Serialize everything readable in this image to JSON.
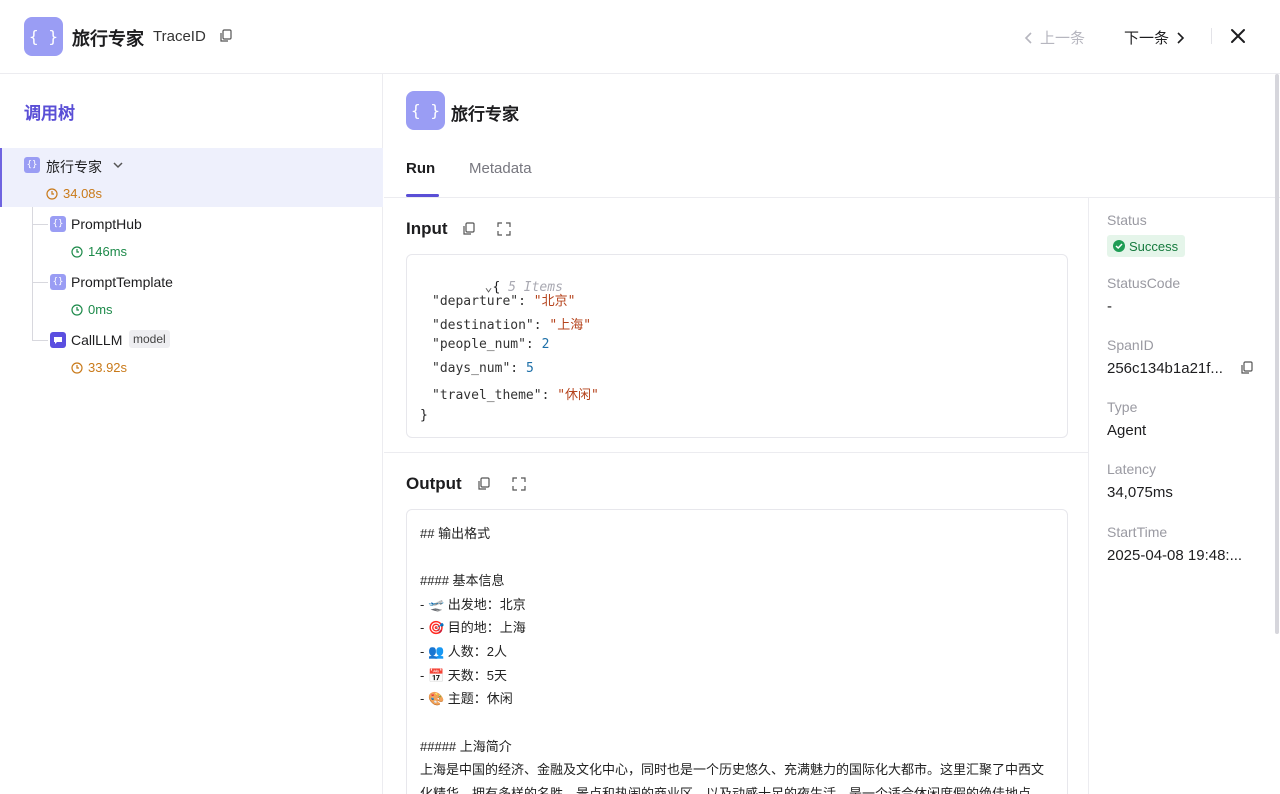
{
  "header": {
    "app_icon": "{ }",
    "title": "旅行专家",
    "trace_label": "TraceID",
    "prev_label": "上一条",
    "next_label": "下一条"
  },
  "tree": {
    "title": "调用树",
    "root": {
      "label": "旅行专家",
      "latency": "34.08s"
    },
    "children": [
      {
        "label": "PromptHub",
        "latency": "146ms",
        "latency_color": "green"
      },
      {
        "label": "PromptTemplate",
        "latency": "0ms",
        "latency_color": "green"
      },
      {
        "label": "CallLLM",
        "tag": "model",
        "latency": "33.92s",
        "latency_color": "orange"
      }
    ]
  },
  "main": {
    "title": "旅行专家",
    "tabs": [
      {
        "label": "Run"
      },
      {
        "label": "Metadata"
      }
    ],
    "input_title": "Input",
    "input": {
      "summary": "5 Items",
      "entries": [
        {
          "key": "\"departure\"",
          "value": "\"北京\"",
          "kind": "string"
        },
        {
          "key": "\"destination\"",
          "value": "\"上海\"",
          "kind": "string"
        },
        {
          "key": "\"people_num\"",
          "value": "2",
          "kind": "number"
        },
        {
          "key": "\"days_num\"",
          "value": "5",
          "kind": "number"
        },
        {
          "key": "\"travel_theme\"",
          "value": "\"休闲\"",
          "kind": "string"
        }
      ]
    },
    "output_title": "Output",
    "output_lines": [
      "## 输出格式",
      "",
      "#### 基本信息",
      "- 🛫 出发地：北京",
      "- 🎯 目的地：上海",
      "- 👥 人数：2人",
      "- 📅 天数：5天",
      "- 🎨 主题：休闲",
      "",
      "##### 上海简介",
      "上海是中国的经济、金融及文化中心，同时也是一个历史悠久、充满魅力的国际化大都市。这里汇聚了中西文",
      "化精华，拥有多样的名胜、景点和热闹的商业区，以及动感十足的夜生活，是一个适合休闲度假的绝佳地点。"
    ]
  },
  "meta": {
    "status_label": "Status",
    "status_value": "Success",
    "status_code_label": "StatusCode",
    "status_code_value": "-",
    "span_id_label": "SpanID",
    "span_id_value": "256c134b1a21f...",
    "type_label": "Type",
    "type_value": "Agent",
    "latency_label": "Latency",
    "latency_value": "34,075ms",
    "start_time_label": "StartTime",
    "start_time_value": "2025-04-08 19:48:..."
  },
  "colors": {
    "accent": "#5a4fd6",
    "icon_bg": "#9a9df4",
    "success": "#1f9d55"
  }
}
